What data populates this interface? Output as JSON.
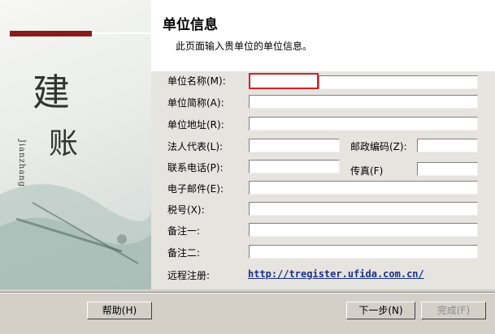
{
  "side_panel": {
    "char_jian": "建",
    "char_zhang": "账",
    "pinyin": "Jianzhang"
  },
  "header": {
    "title": "单位信息",
    "subtitle": "此页面输入贵单位的单位信息。"
  },
  "form": {
    "name_label": "单位名称(M):",
    "name_value": "",
    "name_marker": "①",
    "short_label": "单位简称(A):",
    "address_label": "单位地址(R):",
    "legal_label": "法人代表(L):",
    "postcode_label": "邮政编码(Z):",
    "phone_label": "联系电话(P):",
    "fax_label": "传真(F)",
    "email_label": "电子邮件(E):",
    "tax_label": "税号(X):",
    "note1_label": "备注一:",
    "note2_label": "备注二:",
    "remote_label": "远程注册:",
    "remote_url": "http://tregister.ufida.com.cn/"
  },
  "buttons": {
    "help": "帮助(H)",
    "next": "下一步(N)",
    "finish": "完成(F)"
  },
  "colors": {
    "accent_red": "#8b1a1a",
    "active_border": "#d62020",
    "link": "#1a2f8a"
  }
}
